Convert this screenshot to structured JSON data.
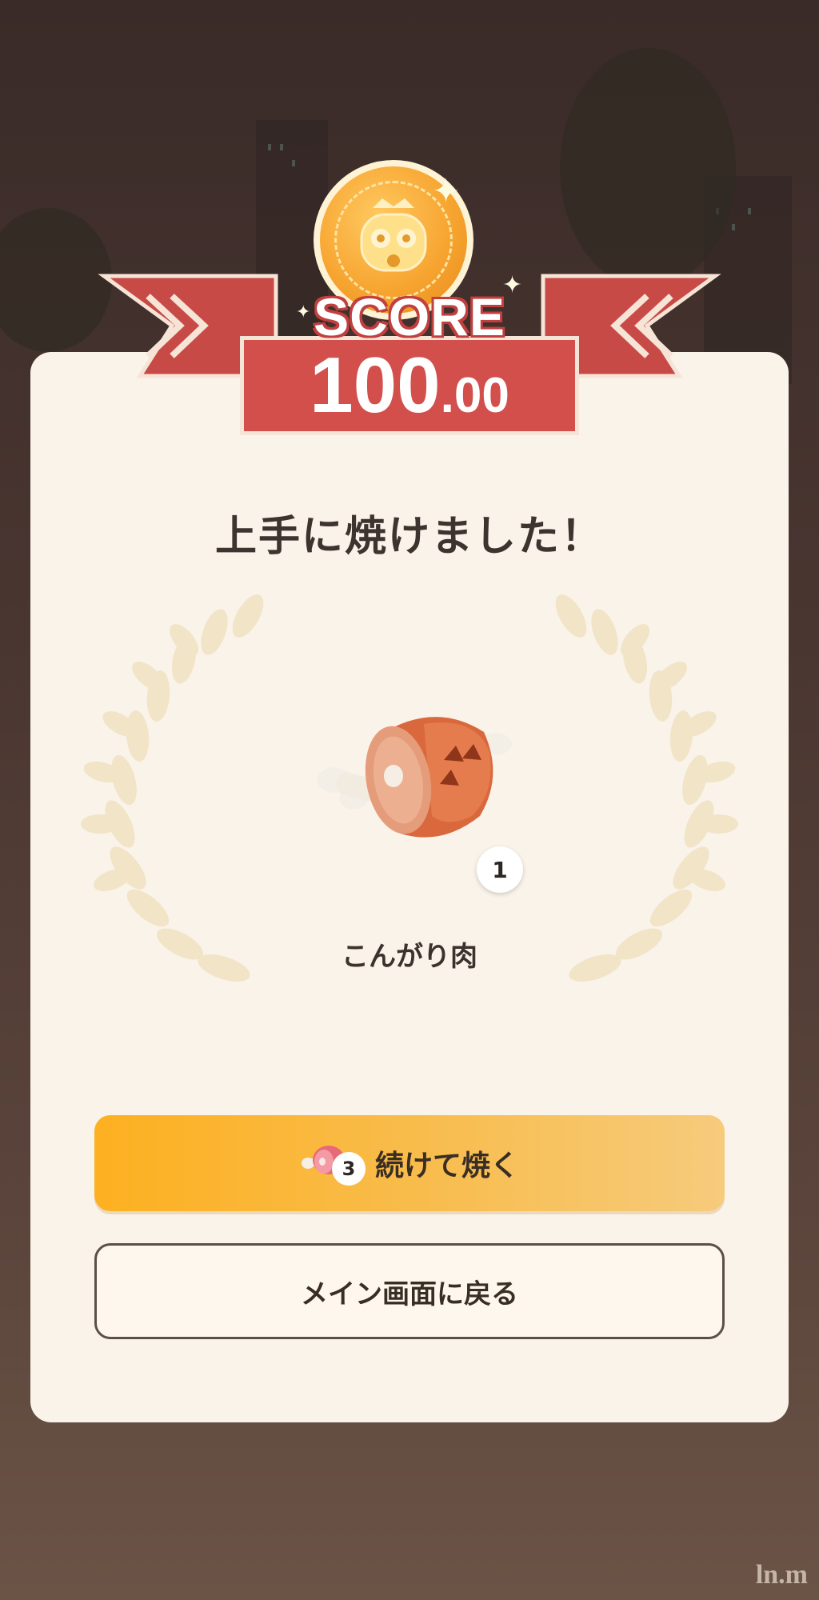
{
  "score": {
    "label": "SCORE",
    "integer": "100",
    "decimal": ".00"
  },
  "result": {
    "headline": "上手に焼けました！"
  },
  "item": {
    "name": "こんがり肉",
    "count": "1",
    "icon": "well-done-steak-icon"
  },
  "actions": {
    "continue_label": "続けて焼く",
    "continue_count": "3",
    "continue_icon": "raw-meat-icon",
    "back_label": "メイン画面に戻る"
  },
  "watermark": "ln.m",
  "colors": {
    "ribbon": "#d24f4c",
    "card": "#faf3ea",
    "primary_button": "#fdb020",
    "laurel": "#f1e4c7"
  }
}
